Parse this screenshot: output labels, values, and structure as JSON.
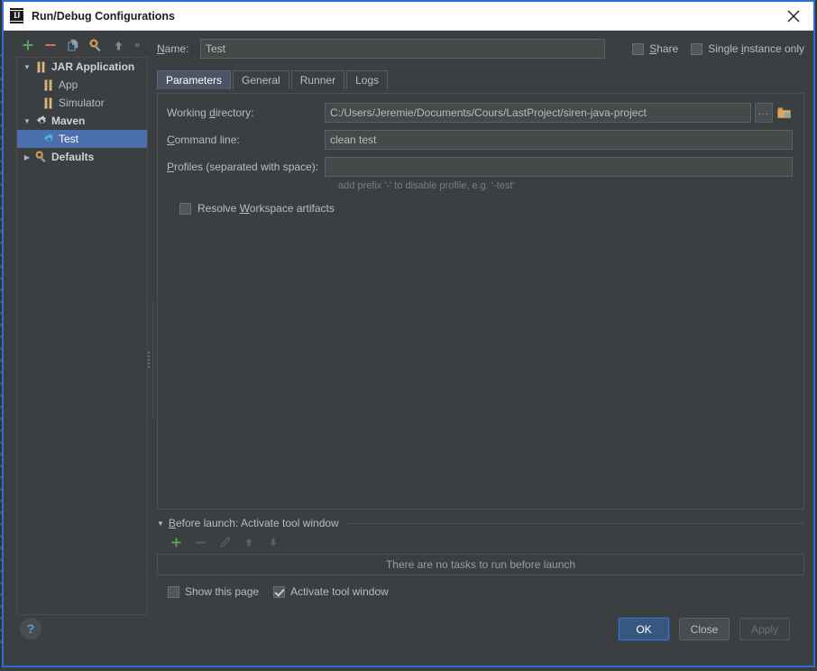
{
  "window": {
    "title": "Run/Debug Configurations",
    "logo_text": "IJ",
    "logo_icon": "intellij-idea-logo",
    "close_icon": "close-icon"
  },
  "left_toolbar": {
    "buttons": [
      {
        "name": "add-configuration-button",
        "icon": "plus-icon",
        "label": "+"
      },
      {
        "name": "remove-configuration-button",
        "icon": "minus-icon",
        "label": "−"
      },
      {
        "name": "copy-configuration-button",
        "icon": "copy-icon",
        "label": "Copy"
      },
      {
        "name": "edit-defaults-button",
        "icon": "wrench-gear-icon",
        "label": "Edit defaults"
      },
      {
        "name": "move-up-button",
        "icon": "arrow-up-icon",
        "label": "Move up"
      },
      {
        "name": "more-options-button",
        "icon": "chevron-double-right-icon",
        "label": "»"
      }
    ]
  },
  "tree": {
    "items": [
      {
        "label": "JAR Application",
        "icon": "jar-icon",
        "level": 0,
        "expanded": true,
        "bold": true,
        "selected": false
      },
      {
        "label": "App",
        "icon": "jar-icon",
        "level": 1,
        "expanded": null,
        "bold": false,
        "selected": false
      },
      {
        "label": "Simulator",
        "icon": "jar-icon",
        "level": 1,
        "expanded": null,
        "bold": false,
        "selected": false
      },
      {
        "label": "Maven",
        "icon": "gear-icon",
        "level": 0,
        "expanded": true,
        "bold": true,
        "selected": false
      },
      {
        "label": "Test",
        "icon": "maven-gear-icon",
        "level": 1,
        "expanded": null,
        "bold": false,
        "selected": true
      },
      {
        "label": "Defaults",
        "icon": "wrench-gear-icon",
        "level": 0,
        "expanded": false,
        "bold": true,
        "selected": false
      }
    ]
  },
  "name_row": {
    "label_prefix": "",
    "label_mnemonic": "N",
    "label_suffix": "ame:",
    "value": "Test"
  },
  "top_checkboxes": [
    {
      "name": "share-checkbox",
      "prefix": "",
      "mnemonic": "S",
      "suffix": "hare",
      "checked": false
    },
    {
      "name": "single-instance-only-checkbox",
      "prefix": "Single ",
      "mnemonic": "i",
      "suffix": "nstance only",
      "checked": false
    }
  ],
  "tabs": [
    {
      "label": "Parameters",
      "active": true
    },
    {
      "label": "General",
      "active": false
    },
    {
      "label": "Runner",
      "active": false
    },
    {
      "label": "Logs",
      "active": false
    }
  ],
  "parameters_tab": {
    "working_directory": {
      "label_prefix": "Working ",
      "label_mnemonic": "d",
      "label_suffix": "irectory:",
      "value": "C:/Users/Jeremie/Documents/Cours/LastProject/siren-java-project",
      "placeholder": "",
      "browse_button_label": "...",
      "folder_icon": "folder-icon"
    },
    "command_line": {
      "label_prefix": "",
      "label_mnemonic": "C",
      "label_suffix": "ommand line:",
      "value": "clean test",
      "placeholder": ""
    },
    "profiles": {
      "label_prefix": "",
      "label_mnemonic": "P",
      "label_suffix": "rofiles (separated with space):",
      "value": "",
      "placeholder": "",
      "hint": "add prefix '-' to disable profile, e.g. '-test'"
    },
    "resolve_workspace_artifacts": {
      "prefix": "Resolve ",
      "mnemonic": "W",
      "suffix": "orkspace artifacts",
      "checked": false
    }
  },
  "before_launch": {
    "title_prefix": "",
    "title_mnemonic": "B",
    "title_suffix": "efore launch: Activate tool window",
    "toolbar": [
      {
        "name": "add-task-button",
        "icon": "plus-icon",
        "enabled": true
      },
      {
        "name": "remove-task-button",
        "icon": "minus-icon",
        "enabled": false
      },
      {
        "name": "edit-task-button",
        "icon": "pencil-icon",
        "enabled": false
      },
      {
        "name": "move-task-up-button",
        "icon": "arrow-up-icon",
        "enabled": false
      },
      {
        "name": "move-task-down-button",
        "icon": "arrow-down-icon",
        "enabled": false
      }
    ],
    "empty_text": "There are no tasks to run before launch",
    "checkboxes": [
      {
        "name": "show-this-page-checkbox",
        "label": "Show this page",
        "checked": false
      },
      {
        "name": "activate-tool-window-checkbox",
        "label": "Activate tool window",
        "checked": true
      }
    ]
  },
  "footer": {
    "help_label": "?",
    "buttons": [
      {
        "name": "ok-button",
        "label": "OK",
        "style": "primary"
      },
      {
        "name": "close-button",
        "label": "Close",
        "style": "normal"
      },
      {
        "name": "apply-button",
        "label": "Apply",
        "style": "disabled"
      }
    ]
  },
  "colors": {
    "window_background": "#3c3f41",
    "field_background": "#45494a",
    "selection_blue": "#4b6eaf",
    "primary_button": "#365880",
    "window_border_focus": "#2d6ed6",
    "accent_cyan": "#4cb5d4",
    "accent_orange": "#d9a04a",
    "accent_green": "#5aa55a",
    "accent_red": "#d0705f",
    "text_primary": "#bbbbbb",
    "text_muted": "#7a7d7f"
  }
}
